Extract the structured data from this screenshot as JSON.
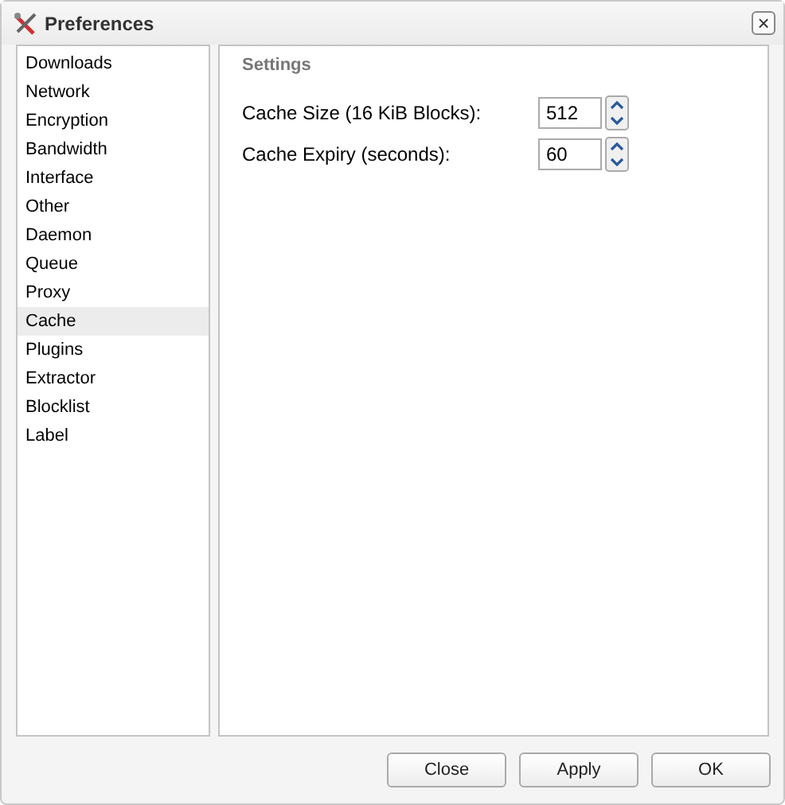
{
  "window": {
    "title": "Preferences",
    "close": "×"
  },
  "sidebar": {
    "items": [
      {
        "label": "Downloads",
        "selected": false
      },
      {
        "label": "Network",
        "selected": false
      },
      {
        "label": "Encryption",
        "selected": false
      },
      {
        "label": "Bandwidth",
        "selected": false
      },
      {
        "label": "Interface",
        "selected": false
      },
      {
        "label": "Other",
        "selected": false
      },
      {
        "label": "Daemon",
        "selected": false
      },
      {
        "label": "Queue",
        "selected": false
      },
      {
        "label": "Proxy",
        "selected": false
      },
      {
        "label": "Cache",
        "selected": true
      },
      {
        "label": "Plugins",
        "selected": false
      },
      {
        "label": "Extractor",
        "selected": false
      },
      {
        "label": "Blocklist",
        "selected": false
      },
      {
        "label": "Label",
        "selected": false
      }
    ]
  },
  "settings": {
    "title": "Settings",
    "fields": [
      {
        "label": "Cache Size (16 KiB Blocks):",
        "value": "512"
      },
      {
        "label": "Cache Expiry (seconds):",
        "value": "60"
      }
    ]
  },
  "buttons": [
    "Close",
    "Apply",
    "OK"
  ]
}
